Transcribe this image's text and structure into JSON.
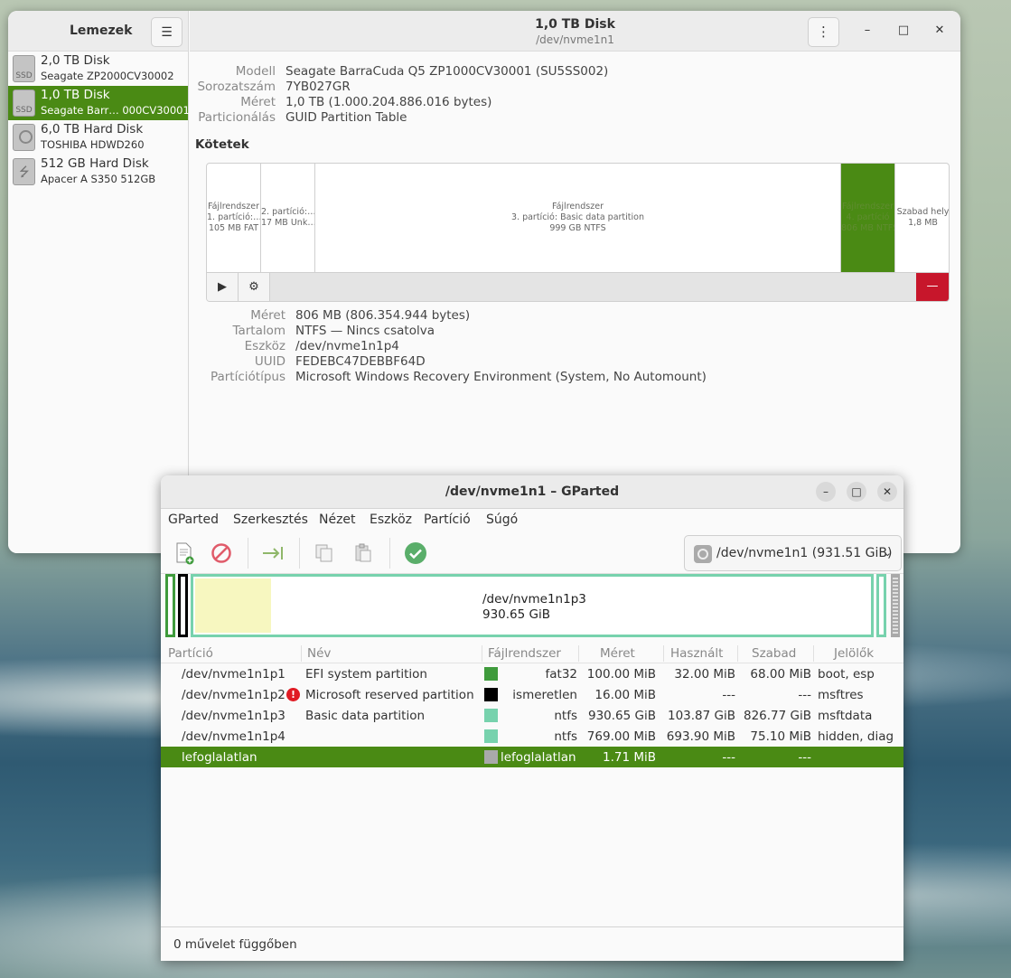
{
  "disks": {
    "sidebar": {
      "title": "Lemezek",
      "items": [
        {
          "name": "2,0 TB Disk",
          "sub": "Seagate ZP2000CV30002",
          "icon_label": "SSD"
        },
        {
          "name": "1,0 TB Disk",
          "sub": "Seagate Barr… 000CV30001",
          "icon_label": "SSD"
        },
        {
          "name": "6,0 TB Hard Disk",
          "sub": "TOSHIBA HDWD260",
          "icon_label": ""
        },
        {
          "name": "512 GB Hard Disk",
          "sub": "Apacer A S350 512GB",
          "icon_label": ""
        }
      ]
    },
    "header": {
      "title": "1,0 TB Disk",
      "subtitle": "/dev/nvme1n1"
    },
    "info": [
      {
        "k": "Modell",
        "v": "Seagate BarraCuda Q5 ZP1000CV30001 (SU5SS002)"
      },
      {
        "k": "Sorozatszám",
        "v": "7YB027GR"
      },
      {
        "k": "Méret",
        "v": "1,0 TB (1.000.204.886.016 bytes)"
      },
      {
        "k": "Particionálás",
        "v": "GUID Partition Table"
      }
    ],
    "volumes_title": "Kötetek",
    "volumes": [
      {
        "l1": "Fájlrendszer",
        "l2": "1. partíció:…",
        "l3": "105 MB FAT"
      },
      {
        "l1": "2. partíció:…",
        "l2": "17 MB Unk…",
        "l3": ""
      },
      {
        "l1": "Fájlrendszer",
        "l2": "3. partíció: Basic data partition",
        "l3": "999 GB NTFS"
      },
      {
        "l1": "Fájlrendszer",
        "l2": "4. partíció",
        "l3": "806 MB NTFS"
      },
      {
        "l1": "Szabad hely",
        "l2": "1,8 MB",
        "l3": ""
      }
    ],
    "vol_buttons": {
      "play": "▶",
      "settings": "⚙",
      "delete": "—"
    },
    "details": [
      {
        "k": "Méret",
        "v": "806 MB (806.354.944 bytes)"
      },
      {
        "k": "Tartalom",
        "v": "NTFS — Nincs csatolva"
      },
      {
        "k": "Eszköz",
        "v": "/dev/nvme1n1p4"
      },
      {
        "k": "UUID",
        "v": "FEDEBC47DEBBF64D"
      },
      {
        "k": "Partíciótípus",
        "v": "Microsoft Windows Recovery Environment (System, No Automount)"
      }
    ]
  },
  "gparted": {
    "title": "/dev/nvme1n1 – GParted",
    "menu": [
      "GParted",
      "Szerkesztés",
      "Nézet",
      "Eszköz",
      "Partíció",
      "Súgó"
    ],
    "device": "/dev/nvme1n1 (931.51 GiB)",
    "map": {
      "label": "/dev/nvme1n1p3",
      "size": "930.65 GiB"
    },
    "columns": [
      "Partíció",
      "Név",
      "Fájlrendszer",
      "Méret",
      "Használt",
      "Szabad",
      "Jelölők"
    ],
    "rows": [
      {
        "partition": "/dev/nvme1n1p1",
        "name": "EFI system partition",
        "fs": "fat32",
        "size": "100.00 MiB",
        "used": "32.00 MiB",
        "free": "68.00 MiB",
        "flags": "boot, esp",
        "color": "#3f9b3c",
        "warn": false
      },
      {
        "partition": "/dev/nvme1n1p2",
        "name": "Microsoft reserved partition",
        "fs": "ismeretlen",
        "size": "16.00 MiB",
        "used": "---",
        "free": "---",
        "flags": "msftres",
        "color": "#000000",
        "warn": true
      },
      {
        "partition": "/dev/nvme1n1p3",
        "name": "Basic data partition",
        "fs": "ntfs",
        "size": "930.65 GiB",
        "used": "103.87 GiB",
        "free": "826.77 GiB",
        "flags": "msftdata",
        "color": "#77d2ad",
        "warn": false
      },
      {
        "partition": "/dev/nvme1n1p4",
        "name": "",
        "fs": "ntfs",
        "size": "769.00 MiB",
        "used": "693.90 MiB",
        "free": "75.10 MiB",
        "flags": "hidden, diag",
        "color": "#77d2ad",
        "warn": false
      },
      {
        "partition": "lefoglalatlan",
        "name": "",
        "fs": "lefoglalatlan",
        "size": "1.71 MiB",
        "used": "---",
        "free": "---",
        "flags": "",
        "color": "#a9a9a9",
        "warn": false
      }
    ],
    "status": "0 művelet függőben"
  }
}
